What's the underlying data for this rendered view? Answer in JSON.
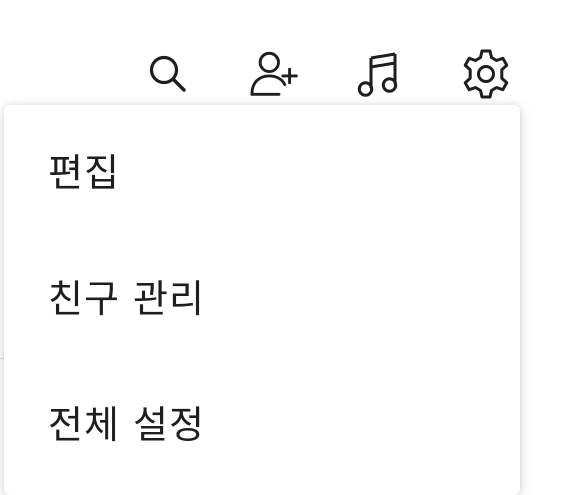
{
  "toolbar": {
    "icons": [
      "search-icon",
      "add-friend-icon",
      "music-icon",
      "gear-icon"
    ]
  },
  "menu": {
    "items": [
      {
        "label": "편집"
      },
      {
        "label": "친구 관리"
      },
      {
        "label": "전체 설정"
      }
    ]
  },
  "colors": {
    "text": "#1e1e1e",
    "menu_background": "#ffffff",
    "page_background": "#ffffff"
  }
}
